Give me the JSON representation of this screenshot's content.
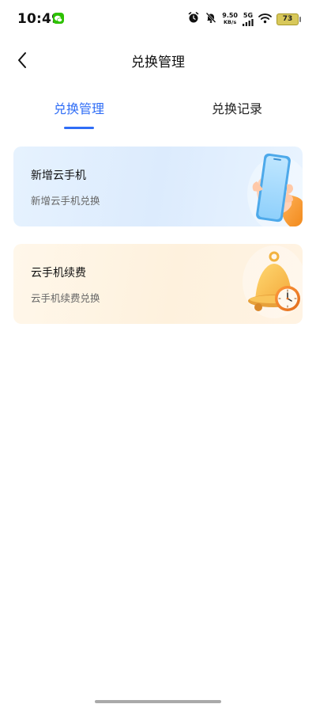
{
  "status_bar": {
    "time": "10:49",
    "speed_value": "9.50",
    "speed_unit": "KB/s",
    "network": "5G",
    "battery": "73"
  },
  "header": {
    "title": "兑换管理"
  },
  "tabs": [
    {
      "label": "兑换管理",
      "active": true
    },
    {
      "label": "兑换记录",
      "active": false
    }
  ],
  "cards": [
    {
      "title": "新增云手机",
      "subtitle": "新增云手机兑换",
      "icon": "phone-in-hand-icon"
    },
    {
      "title": "云手机续费",
      "subtitle": "云手机续费兑换",
      "icon": "bell-clock-icon"
    }
  ],
  "colors": {
    "accent": "#2f6df6",
    "card_blue_bg": "#e3effd",
    "card_orange_bg": "#fef3e2"
  }
}
